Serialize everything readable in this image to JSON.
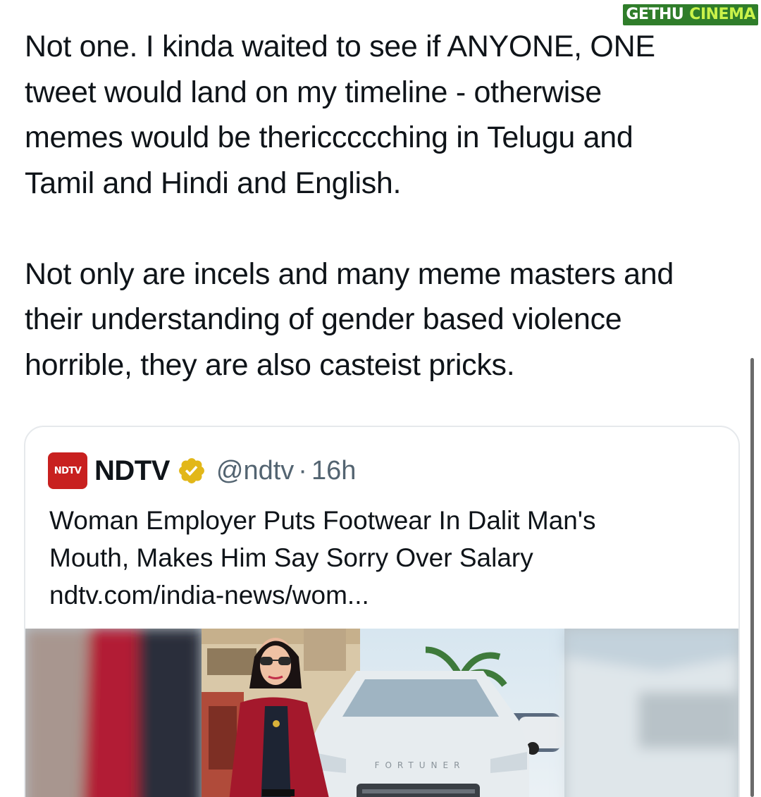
{
  "watermark": {
    "part1": "GETHU",
    "part2": "CINEMA"
  },
  "tweet": {
    "paragraph1": "Not one. I kinda waited to see if ANYONE, ONE\ntweet would land on my timeline - otherwise\nmemes would be thericcccching in Telugu and\nTamil and Hindi and English.",
    "paragraph2": "Not only are incels and many meme masters and\ntheir understanding of gender based violence\nhorrible, they are also casteist pricks."
  },
  "quote": {
    "logo_text": "NDTV",
    "name": "NDTV",
    "handle": "@ndtv",
    "separator": "·",
    "time": "16h",
    "headline_line1": "Woman Employer Puts Footwear In Dalit Man's",
    "headline_line2": "Mouth, Makes Him Say Sorry Over Salary",
    "link": "ndtv.com/india-news/wom...",
    "car_badge": "FORTUNER"
  },
  "colors": {
    "text": "#0f1419",
    "secondary": "#536471",
    "ndtv_red": "#c8201f",
    "verified_gold": "#e2b719",
    "watermark_green": "#2f7d2a",
    "watermark_lime": "#c9f24a"
  }
}
